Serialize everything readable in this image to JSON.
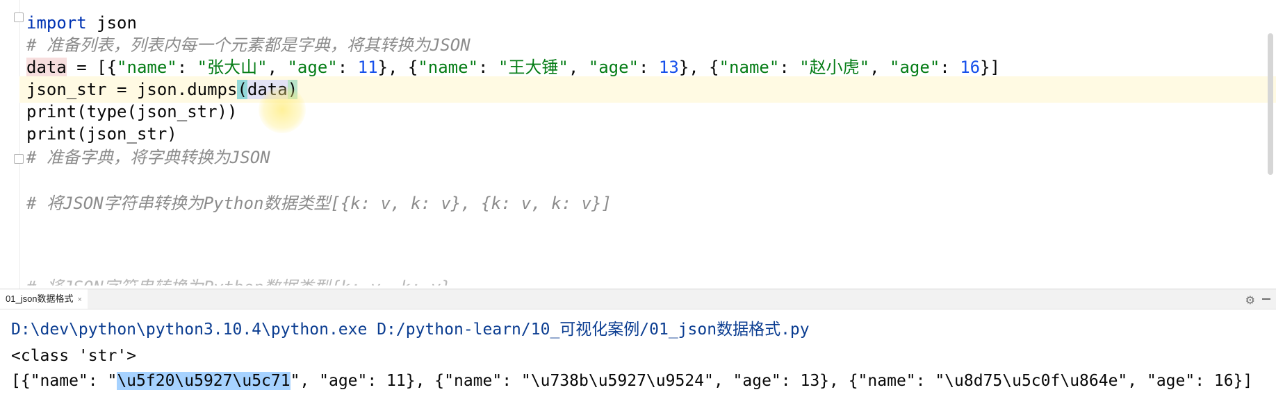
{
  "editor": {
    "lines": [
      {
        "parts": [
          "import",
          " json"
        ]
      },
      {
        "comment": "# 准备列表，列表内每一个元素都是字典，将其转换为JSON"
      },
      {
        "parts": [
          "data",
          " = [{",
          "\"name\"",
          ": ",
          "\"张大山\"",
          ", ",
          "\"age\"",
          ": ",
          "11",
          "}, {",
          "\"name\"",
          ": ",
          "\"王大锤\"",
          ", ",
          "\"age\"",
          ": ",
          "13",
          "}, {",
          "\"name\"",
          ": ",
          "\"赵小虎\"",
          ", ",
          "\"age\"",
          ": ",
          "16",
          "}]"
        ]
      },
      {
        "parts": [
          "json_str = json.dumps",
          "(",
          "data",
          ")"
        ]
      },
      {
        "parts": [
          "print(type(json_str))"
        ]
      },
      {
        "parts": [
          "print(json_str)"
        ]
      },
      {
        "comment": "# 准备字典，将字典转换为JSON"
      },
      {
        "comment": "# 将JSON字符串转换为Python数据类型[{k: v, k: v}, {k: v, k: v}]"
      },
      {
        "comment": "# 将JSON字符串转换为Python数据类型{k: v, k: v}"
      }
    ]
  },
  "run_panel": {
    "tab_label": "01_json数据格式",
    "close_icon": "×",
    "gear_icon": "⚙",
    "console": {
      "command": "D:\\dev\\python\\python3.10.4\\python.exe D:/python-learn/10_可视化案例/01_json数据格式.py",
      "line2": "<class 'str'>",
      "line3_pre": "[{\"name\": \"",
      "line3_sel": "\\u5f20\\u5927\\u5c71",
      "line3_post": "\", \"age\": 11}, {\"name\": \"\\u738b\\u5927\\u9524\", \"age\": 13}, {\"name\": \"\\u8d75\\u5c0f\\u864e\", \"age\": 16}]"
    }
  },
  "colors": {
    "keyword": "#0033b3",
    "string": "#067d17",
    "number": "#1750eb",
    "comment": "#8c8c8c",
    "selection": "#a6d2ff",
    "current_line": "#fffae3"
  }
}
